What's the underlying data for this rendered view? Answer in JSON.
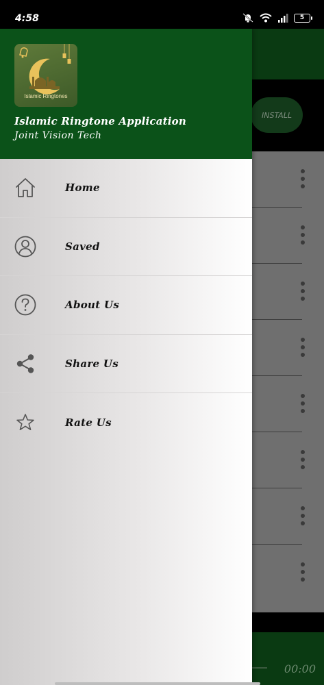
{
  "status_bar": {
    "time": "4:58",
    "battery": "5"
  },
  "background": {
    "install_label": "INSTALL",
    "player_time": "00:00"
  },
  "drawer": {
    "logo_text": "Islamic Ringtones",
    "title": "Islamic Ringtone Application",
    "subtitle": "Joint Vision Tech",
    "items": [
      {
        "label": "Home",
        "icon": "home-icon"
      },
      {
        "label": "Saved",
        "icon": "user-icon"
      },
      {
        "label": "About Us",
        "icon": "help-icon"
      },
      {
        "label": "Share Us",
        "icon": "share-icon"
      },
      {
        "label": "Rate Us",
        "icon": "star-icon"
      }
    ]
  },
  "colors": {
    "header_green": "#0b5219",
    "dim_gray": "#6f6f6f",
    "gold": "#e9c25b"
  }
}
